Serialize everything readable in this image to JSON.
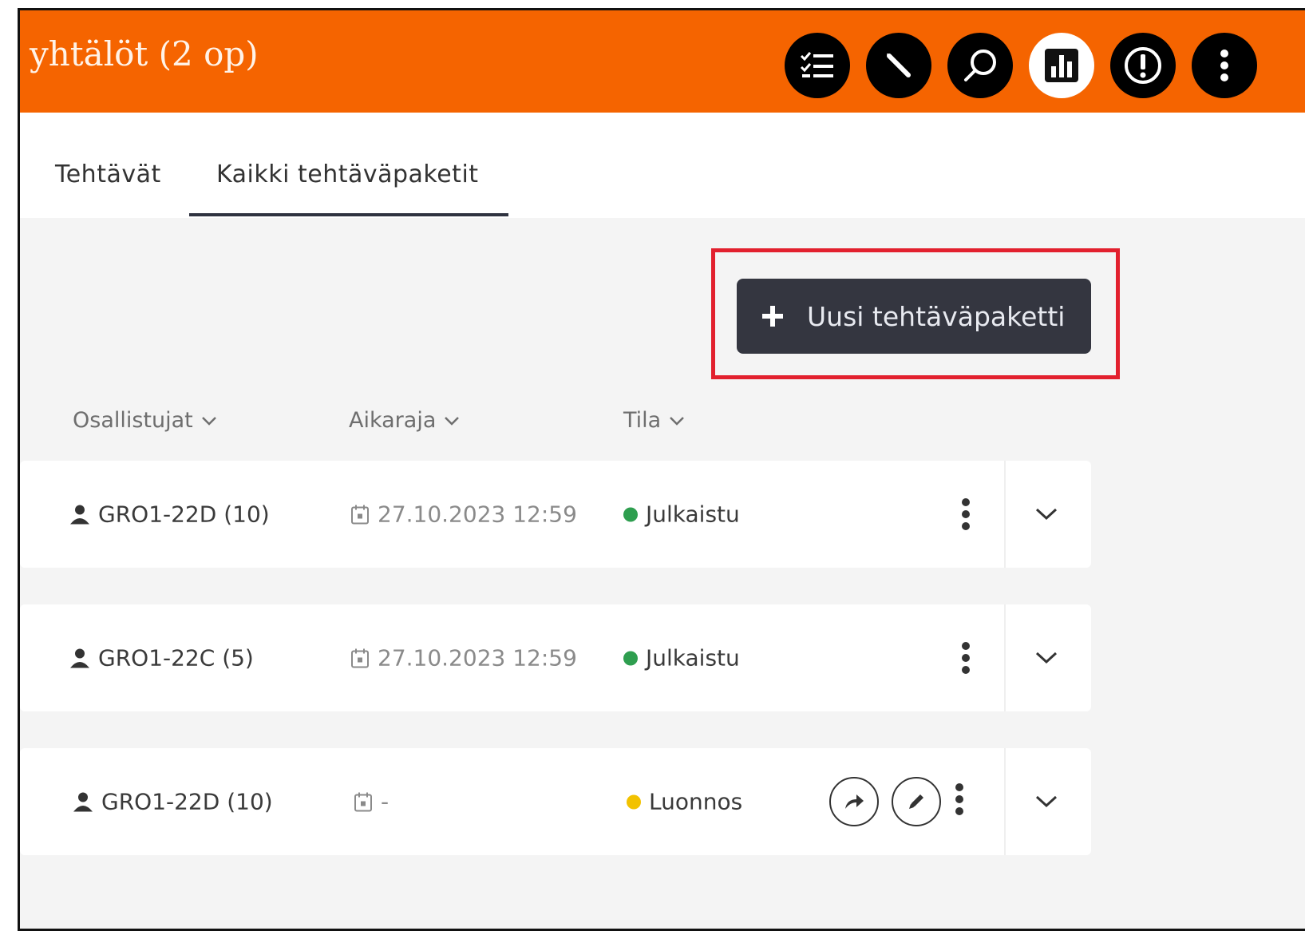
{
  "header": {
    "course_title": "yhtälöt (2 op)",
    "icons": [
      "checklist-icon",
      "pencil-icon",
      "search-icon",
      "bar-chart-icon",
      "alert-icon",
      "more-vertical-icon"
    ]
  },
  "tabs": [
    {
      "label": "Tehtävät"
    },
    {
      "label": "Kaikki tehtäväpaketit",
      "active": true
    }
  ],
  "toolbar": {
    "new_package_label": "Uusi tehtäväpaketti"
  },
  "columns": {
    "participants": "Osallistujat",
    "deadline": "Aikaraja",
    "status": "Tila"
  },
  "rows": [
    {
      "participants": "GRO1-22D (10)",
      "deadline": "27.10.2023  12:59",
      "status": "Julkaistu",
      "status_color": "#2e9e4f"
    },
    {
      "participants": "GRO1-22C (5)",
      "deadline": "27.10.2023  12:59",
      "status": "Julkaistu",
      "status_color": "#2e9e4f"
    },
    {
      "participants": "GRO1-22D (10)",
      "deadline": "-",
      "status": "Luonnos",
      "status_color": "#f2c200"
    }
  ],
  "colors": {
    "brand": "#f56400",
    "button": "#343640",
    "highlight": "#e2202e"
  }
}
